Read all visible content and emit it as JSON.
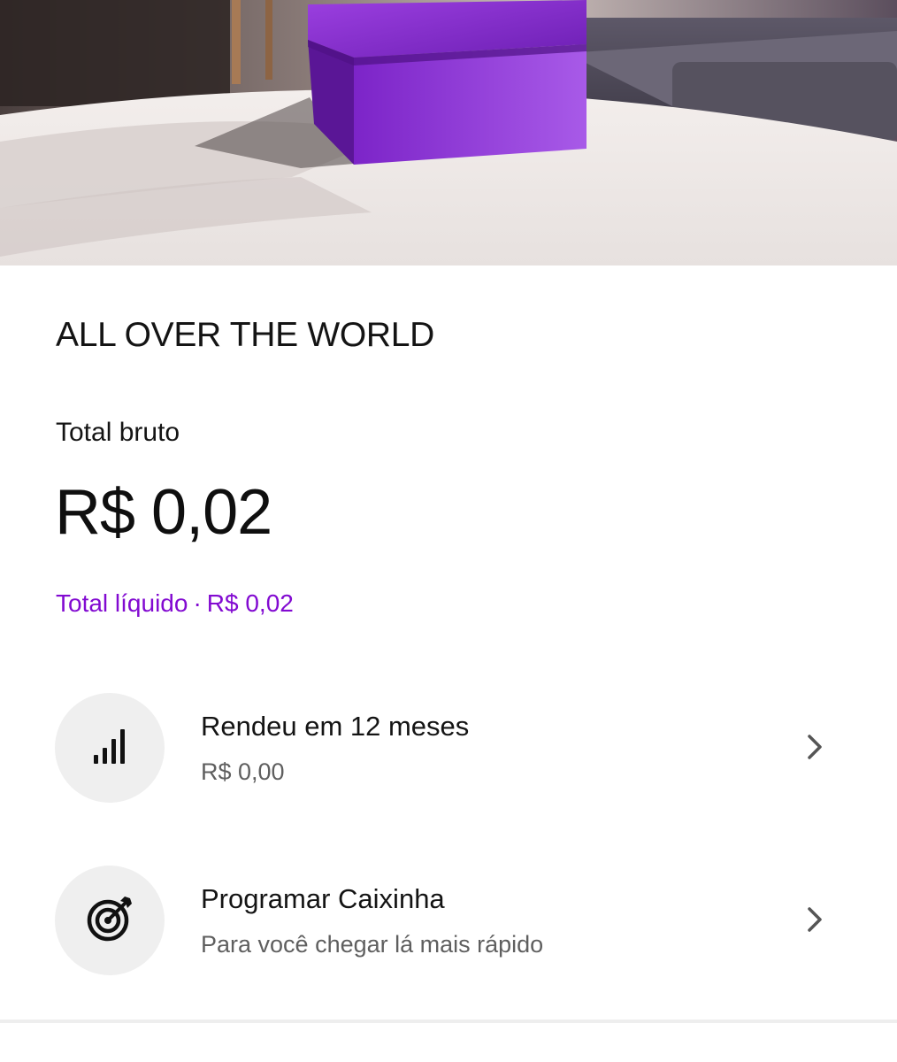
{
  "caixinha": {
    "name": "ALL OVER THE WORLD"
  },
  "totals": {
    "bruto_label": "Total bruto",
    "bruto_value": "R$ 0,02",
    "liquido_label": "Total líquido",
    "liquido_separator": "·",
    "liquido_value": "R$ 0,02"
  },
  "rows": [
    {
      "title": "Rendeu em 12 meses",
      "subtitle": "R$ 0,00",
      "icon": "signal-bars-icon"
    },
    {
      "title": "Programar Caixinha",
      "subtitle": "Para você chegar lá mais rápido",
      "icon": "target-icon"
    }
  ],
  "colors": {
    "accent": "#820ad1",
    "icon_circle": "#efefef",
    "box_purple": "#8a2bd0"
  }
}
